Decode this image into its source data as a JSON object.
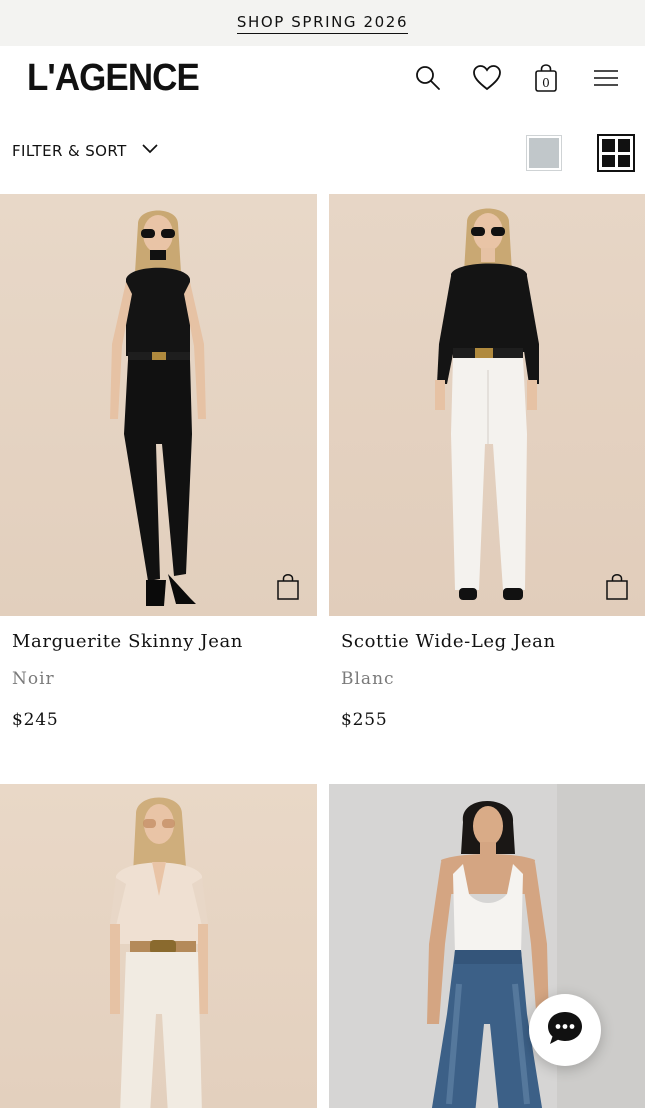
{
  "promo": {
    "label": "SHOP SPRING 2026"
  },
  "header": {
    "logo": "L'AGENCE",
    "icons": [
      "search-icon",
      "heart-icon",
      "shopping-bag-icon",
      "menu-icon"
    ],
    "bag_count": "0"
  },
  "filter": {
    "label": "FILTER & SORT",
    "view_options": [
      "single-column-view",
      "four-grid-view"
    ],
    "active_view": "four-grid-view"
  },
  "products": [
    {
      "name": "Marguerite Skinny Jean",
      "color": "Noir",
      "price": "$245"
    },
    {
      "name": "Scottie Wide-Leg Jean",
      "color": "Blanc",
      "price": "$255"
    },
    {
      "name": "",
      "color": "",
      "price": ""
    },
    {
      "name": "",
      "color": "",
      "price": ""
    }
  ],
  "colors": {
    "photo_beige": "#e6d6c5",
    "photo_gray": "#d4d3d2",
    "view_swatch": "#c1c7ca"
  },
  "chat": {
    "icon": "chat-bubble-icon"
  }
}
